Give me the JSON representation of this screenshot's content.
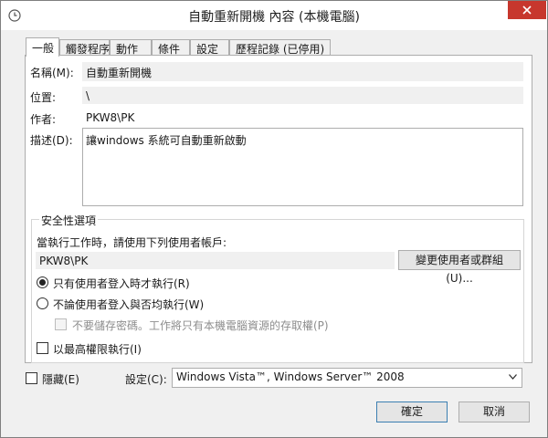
{
  "window": {
    "title": "自動重新開機 內容 (本機電腦)"
  },
  "tabs": [
    {
      "label": "一般",
      "active": true
    },
    {
      "label": "觸發程序"
    },
    {
      "label": "動作"
    },
    {
      "label": "條件"
    },
    {
      "label": "設定"
    },
    {
      "label": "歷程記錄 (已停用)"
    }
  ],
  "general": {
    "name_label": "名稱(M):",
    "name_value": "自動重新開機",
    "location_label": "位置:",
    "location_value": "\\",
    "author_label": "作者:",
    "author_value": "PKW8\\PK",
    "description_label": "描述(D):",
    "description_value": "讓windows 系統可自動重新啟動"
  },
  "security": {
    "group_title": "安全性選項",
    "run_as_label": "當執行工作時，請使用下列使用者帳戶:",
    "user_account": "PKW8\\PK",
    "change_user_button": "變更使用者或群組(U)...",
    "radio_logged_on": "只有使用者登入時才執行(R)",
    "radio_logged_on_selected": true,
    "radio_whether": "不論使用者登入與否均執行(W)",
    "no_store_password": "不要儲存密碼。工作將只有本機電腦資源的存取權(P)",
    "highest_privileges": "以最高權限執行(I)"
  },
  "footer": {
    "hidden_label": "隱藏(E)",
    "configure_label": "設定(C):",
    "configure_value": "Windows Vista™, Windows Server™ 2008",
    "ok_button": "確定",
    "cancel_button": "取消"
  },
  "colors": {
    "close_button": "#c7372d",
    "ok_button_border": "#3c7fb1"
  }
}
